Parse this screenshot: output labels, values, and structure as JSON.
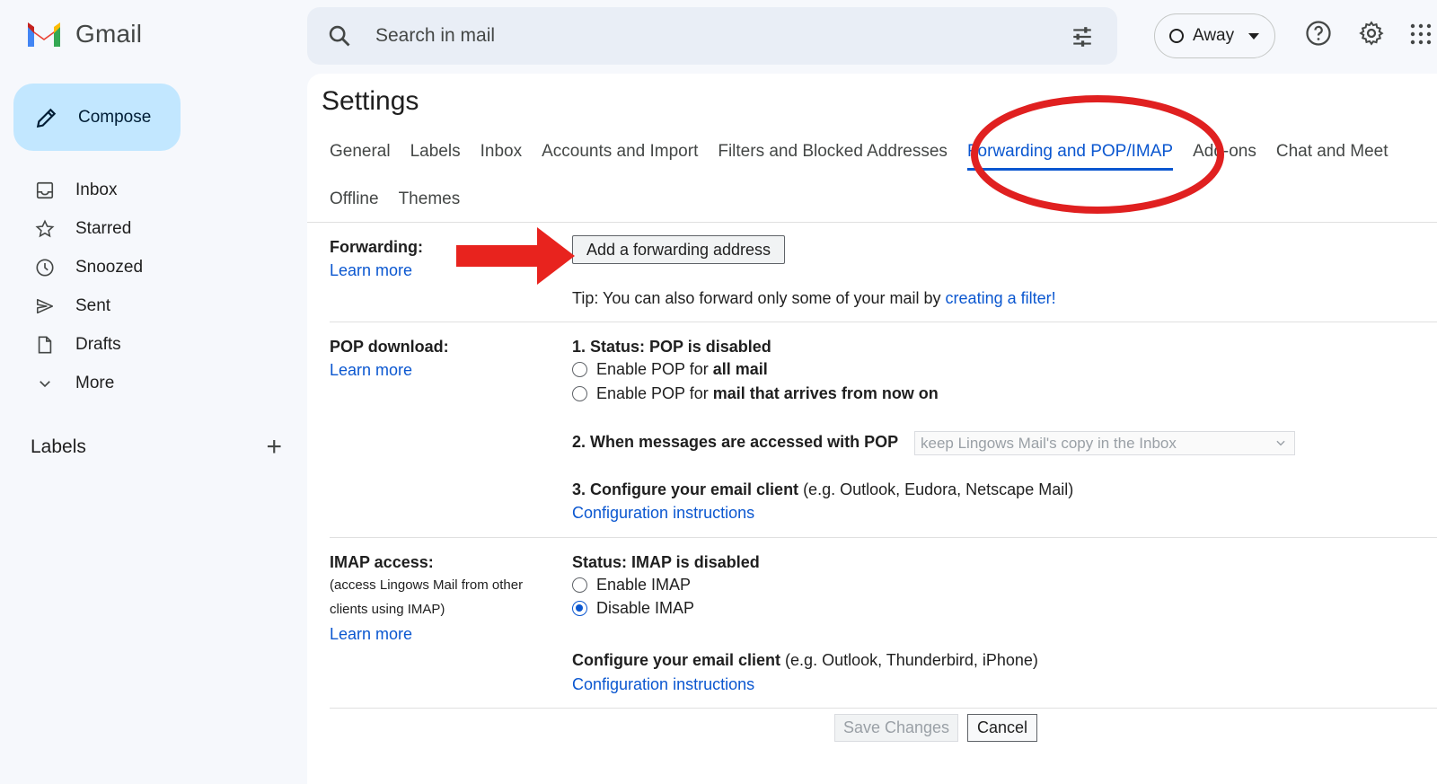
{
  "app": {
    "name": "Gmail"
  },
  "search": {
    "placeholder": "Search in mail"
  },
  "status": {
    "label": "Away"
  },
  "sidebar": {
    "compose_label": "Compose",
    "items": [
      {
        "label": "Inbox",
        "icon": "inbox-icon"
      },
      {
        "label": "Starred",
        "icon": "star-icon"
      },
      {
        "label": "Snoozed",
        "icon": "clock-icon"
      },
      {
        "label": "Sent",
        "icon": "send-icon"
      },
      {
        "label": "Drafts",
        "icon": "draft-icon"
      },
      {
        "label": "More",
        "icon": "chevron-down-icon"
      }
    ],
    "labels_heading": "Labels"
  },
  "settings": {
    "title": "Settings",
    "tabs_row1": [
      "General",
      "Labels",
      "Inbox",
      "Accounts and Import",
      "Filters and Blocked Addresses",
      "Forwarding and POP/IMAP",
      "Add-ons",
      "Chat and Meet"
    ],
    "tabs_row2": [
      "Offline",
      "Themes"
    ],
    "active_tab": "Forwarding and POP/IMAP"
  },
  "forwarding": {
    "label": "Forwarding:",
    "learn_more": "Learn more",
    "button": "Add a forwarding address",
    "tip_prefix": "Tip: You can also forward only some of your mail by ",
    "tip_link": "creating a filter!"
  },
  "pop": {
    "label": "POP download:",
    "learn_more": "Learn more",
    "status": "1. Status: POP is disabled",
    "opt1_prefix": "Enable POP for ",
    "opt1_bold": "all mail",
    "opt2_prefix": "Enable POP for ",
    "opt2_bold": "mail that arrives from now on",
    "when_label": "2. When messages are accessed with POP",
    "when_value": "keep Lingows Mail's copy in the Inbox",
    "config_bold": "3. Configure your email client",
    "config_rest": " (e.g. Outlook, Eudora, Netscape Mail)",
    "config_link": "Configuration instructions"
  },
  "imap": {
    "label": "IMAP access:",
    "sub1": "(access Lingows Mail from other",
    "sub2": "clients using IMAP)",
    "learn_more": "Learn more",
    "status": "Status: IMAP is disabled",
    "enable": "Enable IMAP",
    "disable": "Disable IMAP",
    "selected": "Disable IMAP",
    "config_bold": "Configure your email client",
    "config_rest": " (e.g. Outlook, Thunderbird, iPhone)",
    "config_link": "Configuration instructions"
  },
  "actions": {
    "save": "Save Changes",
    "cancel": "Cancel"
  },
  "colors": {
    "accent": "#0b57d0",
    "annotation": "#e02020",
    "compose_bg": "#c2e7ff"
  }
}
